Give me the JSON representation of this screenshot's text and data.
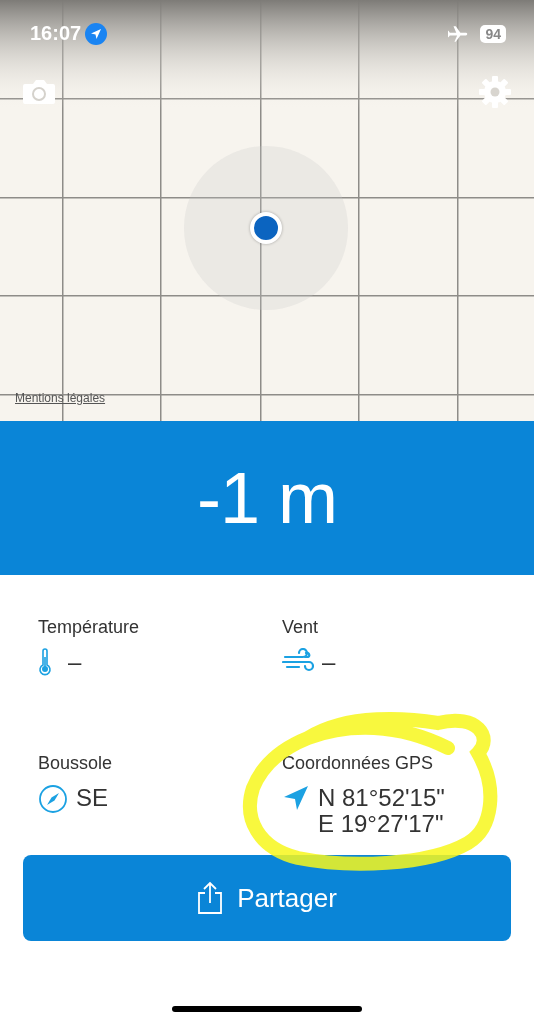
{
  "status_bar": {
    "time": "16:07",
    "battery": "94"
  },
  "map": {
    "legal_link": "Mentions légales"
  },
  "altitude": {
    "value": "-1 m"
  },
  "readings": [
    {
      "kind": "temperature",
      "label": "Température",
      "lines": [
        "–"
      ]
    },
    {
      "kind": "wind",
      "label": "Vent",
      "lines": [
        "–"
      ]
    },
    {
      "kind": "compass",
      "label": "Boussole",
      "lines": [
        "SE"
      ]
    },
    {
      "kind": "gps",
      "label": "Coordonnées GPS",
      "lines": [
        "N 81°52'15\"",
        "E 19°27'17\""
      ]
    }
  ],
  "share_button": {
    "label": "Partager"
  },
  "annotation": {
    "kind": "scribble"
  }
}
